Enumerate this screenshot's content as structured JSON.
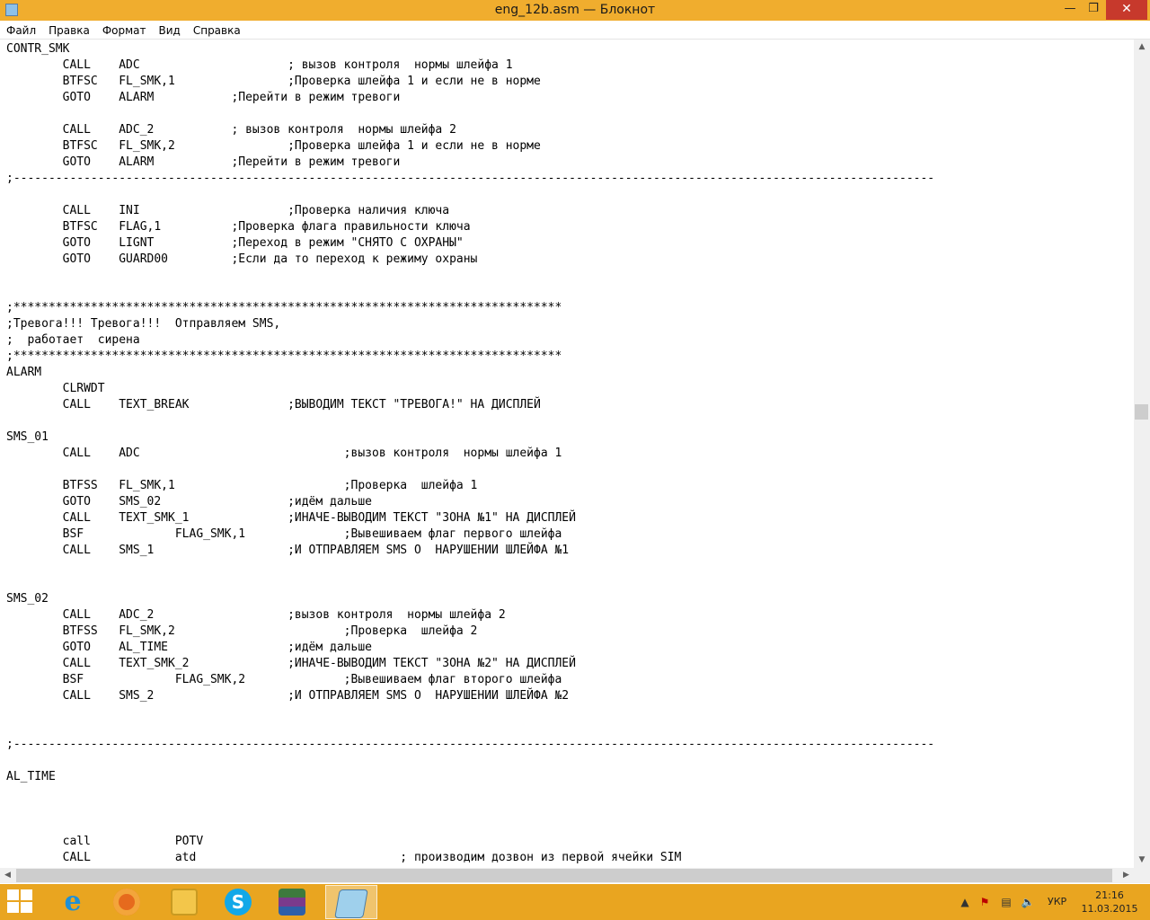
{
  "window": {
    "title": "eng_12b.asm — Блокнот"
  },
  "menu": {
    "items": [
      "Файл",
      "Правка",
      "Формат",
      "Вид",
      "Справка"
    ]
  },
  "editor": {
    "lines": [
      "CONTR_SMK",
      "        CALL    ADC                     ; вызов контроля  нормы шлейфа 1",
      "        BTFSC   FL_SMK,1                ;Проверка шлейфа 1 и если не в норме",
      "        GOTO    ALARM           ;Перейти в режим тревоги",
      "",
      "        CALL    ADC_2           ; вызов контроля  нормы шлейфа 2",
      "        BTFSC   FL_SMK,2                ;Проверка шлейфа 1 и если не в норме",
      "        GOTO    ALARM           ;Перейти в режим тревоги",
      ";-----------------------------------------------------------------------------------------------------------------------------------",
      "",
      "        CALL    INI                     ;Проверка наличия ключа",
      "        BTFSC   FLAG,1          ;Проверка флага правильности ключа",
      "        GOTO    LIGNT           ;Переход в режим \"СНЯТО С ОХРАНЫ\"",
      "        GOTO    GUARD00         ;Если да то переход к режиму охраны",
      "",
      "",
      ";******************************************************************************",
      ";Тревога!!! Тревога!!!  Отправляем SMS,",
      ";  работает  сирена",
      ";******************************************************************************",
      "ALARM",
      "        CLRWDT",
      "        CALL    TEXT_BREAK              ;ВЫВОДИМ ТЕКСТ \"ТРЕВОГА!\" НА ДИСПЛЕЙ",
      "",
      "SMS_01",
      "        CALL    ADC                             ;вызов контроля  нормы шлейфа 1",
      "",
      "        BTFSS   FL_SMK,1                        ;Проверка  шлейфа 1",
      "        GOTO    SMS_02                  ;идём дальше",
      "        CALL    TEXT_SMK_1              ;ИНАЧЕ-ВЫВОДИМ ТЕКСТ \"ЗОНА №1\" НА ДИСПЛЕЙ",
      "        BSF             FLAG_SMK,1              ;Вывешиваем флаг первого шлейфа",
      "        CALL    SMS_1                   ;И ОТПРАВЛЯЕМ SMS О  НАРУШЕНИИ ШЛЕЙФА №1",
      "",
      "",
      "SMS_02",
      "        CALL    ADC_2                   ;вызов контроля  нормы шлейфа 2",
      "        BTFSS   FL_SMK,2                        ;Проверка  шлейфа 2",
      "        GOTO    AL_TIME                 ;идём дальше",
      "        CALL    TEXT_SMK_2              ;ИНАЧЕ-ВЫВОДИМ ТЕКСТ \"ЗОНА №2\" НА ДИСПЛЕЙ",
      "        BSF             FLAG_SMK,2              ;Вывешиваем флаг второго шлейфа",
      "        CALL    SMS_2                   ;И ОТПРАВЛЯЕМ SMS О  НАРУШЕНИИ ШЛЕЙФА №2",
      "",
      "",
      ";-----------------------------------------------------------------------------------------------------------------------------------",
      "",
      "AL_TIME",
      "",
      "",
      "",
      "        call            POTV",
      "        CALL            atd                             ; производим дозвон из первой ячейки SIM"
    ]
  },
  "taskbar": {
    "apps": [
      {
        "name": "internet-explorer",
        "glyph": "e",
        "color": "#1e90d6"
      },
      {
        "name": "firefox",
        "glyph": "",
        "color": "#e66a1d"
      },
      {
        "name": "file-explorer",
        "glyph": "",
        "color": "#f3c64a"
      },
      {
        "name": "skype",
        "glyph": "S",
        "color": "#12a8e8"
      },
      {
        "name": "winrar",
        "glyph": "",
        "color": "#7a3a8c"
      },
      {
        "name": "notepad",
        "glyph": "",
        "color": "#9fd0ec"
      }
    ],
    "language": "УКР",
    "time": "21:16",
    "date": "11.03.2015"
  }
}
